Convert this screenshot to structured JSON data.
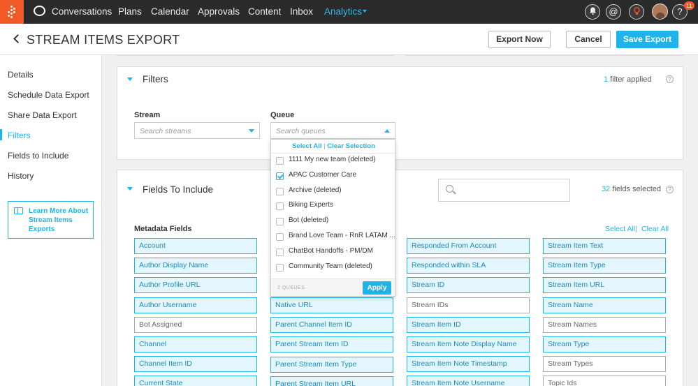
{
  "nav": {
    "items": [
      "Conversations",
      "Plans",
      "Calendar",
      "Approvals",
      "Content",
      "Inbox",
      "Analytics"
    ],
    "active": "Analytics",
    "notification_count": "11",
    "at_symbol": "@",
    "help_symbol": "?"
  },
  "header": {
    "title": "STREAM ITEMS EXPORT",
    "export_now": "Export Now",
    "cancel": "Cancel",
    "save_export": "Save Export"
  },
  "sidebar": {
    "items": [
      "Details",
      "Schedule Data Export",
      "Share Data Export",
      "Filters",
      "Fields to Include",
      "History"
    ],
    "active": "Filters",
    "learn_more": "Learn More About Stream Items Exports"
  },
  "filters": {
    "title": "Filters",
    "applied_count": "1",
    "applied_label": "filter applied",
    "stream_label": "Stream",
    "stream_placeholder": "Search streams",
    "queue_label": "Queue",
    "queue_placeholder": "Search queues"
  },
  "queue_dropdown": {
    "select_all": "Select All",
    "separator": "|",
    "clear_selection": "Clear Selection",
    "options": [
      {
        "label": "1111 My new team (deleted)",
        "checked": false
      },
      {
        "label": "APAC Customer Care",
        "checked": true
      },
      {
        "label": "Archive (deleted)",
        "checked": false
      },
      {
        "label": "Biking Experts",
        "checked": false
      },
      {
        "label": "Bot (deleted)",
        "checked": false
      },
      {
        "label": "Brand Love Team - RnR LATAM ...",
        "checked": false
      },
      {
        "label": "ChatBot Handoffs - PM/DM",
        "checked": false
      },
      {
        "label": "Community Team (deleted)",
        "checked": false
      }
    ],
    "count_label": "2 QUEUES",
    "apply": "Apply"
  },
  "fields": {
    "title": "Fields To Include",
    "selected_count": "32",
    "selected_label": "fields selected",
    "metadata_label": "Metadata Fields",
    "select_all": "Select All",
    "separator": "|",
    "clear_all": "Clear All",
    "columns": [
      [
        {
          "label": "Account",
          "on": true
        },
        {
          "label": "Author Display Name",
          "on": true
        },
        {
          "label": "Author Profile URL",
          "on": true
        },
        {
          "label": "Author Username",
          "on": true
        },
        {
          "label": "Bot Assigned",
          "on": false
        },
        {
          "label": "Channel",
          "on": true
        },
        {
          "label": "Channel Item ID",
          "on": true
        },
        {
          "label": "Current State",
          "on": true
        }
      ],
      [
        {
          "label": "Native URL",
          "on": true
        },
        {
          "label": "Parent Channel Item ID",
          "on": true
        },
        {
          "label": "Parent Stream Item ID",
          "on": true
        },
        {
          "label": "Parent Stream Item Type",
          "on": true
        },
        {
          "label": "Parent Stream Item URL",
          "on": true
        }
      ],
      [
        {
          "label": "Responded From Account",
          "on": true
        },
        {
          "label": "Responded within SLA",
          "on": true
        },
        {
          "label": "Stream ID",
          "on": true
        },
        {
          "label": "Stream IDs",
          "on": false
        },
        {
          "label": "Stream Item ID",
          "on": true
        },
        {
          "label": "Stream Item Note Display Name",
          "on": true
        },
        {
          "label": "Stream Item Note Timestamp",
          "on": true
        },
        {
          "label": "Stream Item Note Username",
          "on": true
        }
      ],
      [
        {
          "label": "Stream Item Text",
          "on": true
        },
        {
          "label": "Stream Item Type",
          "on": true
        },
        {
          "label": "Stream Item URL",
          "on": true
        },
        {
          "label": "Stream Name",
          "on": true
        },
        {
          "label": "Stream Names",
          "on": false
        },
        {
          "label": "Stream Type",
          "on": true
        },
        {
          "label": "Stream Types",
          "on": false
        },
        {
          "label": "Topic Ids",
          "on": false
        }
      ]
    ]
  }
}
